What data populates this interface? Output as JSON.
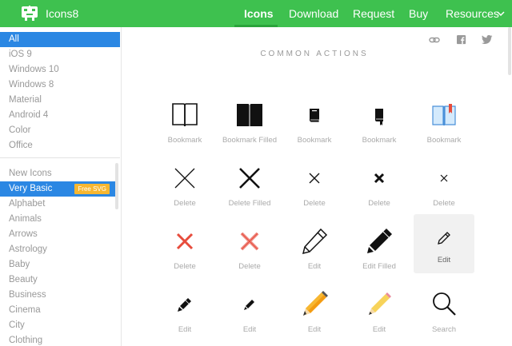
{
  "header": {
    "brand": "Icons8",
    "nav": [
      "Icons",
      "Download",
      "Request",
      "Buy",
      "Resources"
    ]
  },
  "sidebar": {
    "platforms": [
      "All",
      "iOS 9",
      "Windows 10",
      "Windows 8",
      "Material",
      "Android 4",
      "Color",
      "Office"
    ],
    "categories": [
      "New Icons",
      "Very Basic",
      "Alphabet",
      "Animals",
      "Arrows",
      "Astrology",
      "Baby",
      "Beauty",
      "Business",
      "Cinema",
      "City",
      "Clothing"
    ],
    "badge": "Free SVG"
  },
  "main": {
    "section_title": "COMMON ACTIONS",
    "icons": [
      {
        "label": "Bookmark",
        "icon": "book-outline-icon"
      },
      {
        "label": "Bookmark Filled",
        "icon": "book-filled-icon"
      },
      {
        "label": "Bookmark",
        "icon": "book-small-icon"
      },
      {
        "label": "Bookmark",
        "icon": "book-small-ribbon-icon"
      },
      {
        "label": "Bookmark",
        "icon": "book-color-icon"
      },
      {
        "label": "Delete",
        "icon": "x-thin-icon"
      },
      {
        "label": "Delete Filled",
        "icon": "x-bold-icon"
      },
      {
        "label": "Delete",
        "icon": "x-small-icon"
      },
      {
        "label": "Delete",
        "icon": "x-small-bold-icon"
      },
      {
        "label": "Delete",
        "icon": "x-tiny-icon"
      },
      {
        "label": "Delete",
        "icon": "x-red-icon"
      },
      {
        "label": "Delete",
        "icon": "x-red-light-icon"
      },
      {
        "label": "Edit",
        "icon": "pencil-outline-icon"
      },
      {
        "label": "Edit Filled",
        "icon": "pencil-filled-icon"
      },
      {
        "label": "Edit",
        "icon": "pencil-small-icon"
      },
      {
        "label": "Edit",
        "icon": "pencil-dark-icon"
      },
      {
        "label": "Edit",
        "icon": "pencil-mini-icon"
      },
      {
        "label": "Edit",
        "icon": "pencil-orange-icon"
      },
      {
        "label": "Edit",
        "icon": "pencil-yellow-icon"
      },
      {
        "label": "Search",
        "icon": "search-icon"
      }
    ]
  },
  "colors": {
    "brand": "#3ec14f",
    "selected": "#2b87e3",
    "badge": "#f7b731",
    "red": "#e74c3c"
  }
}
